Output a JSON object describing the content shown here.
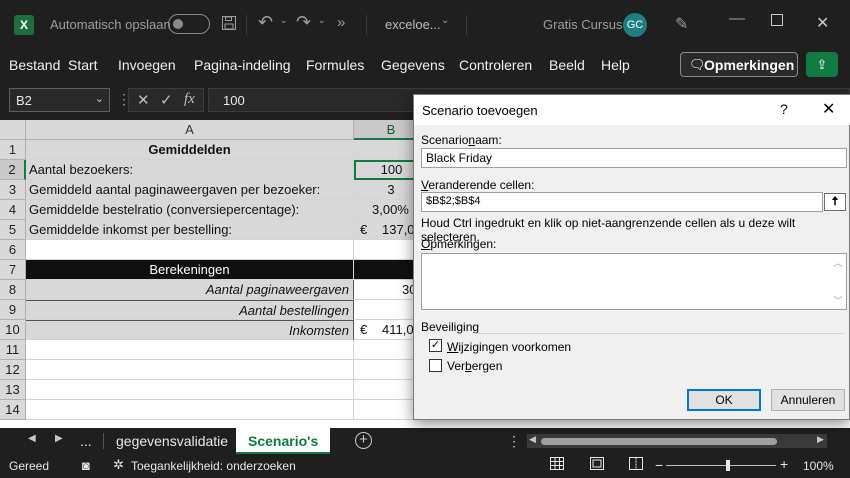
{
  "titlebar": {
    "app_logo": "X",
    "autosave_label": "Automatisch opslaan",
    "filename": "exceloe...",
    "more_glyph": "»",
    "title": "Gratis Cursus",
    "avatar": "GC",
    "icons": [
      "excel-logo",
      "save-icon",
      "undo-icon",
      "redo-icon",
      "pen-icon",
      "minimize-icon",
      "maximize-icon",
      "close-icon"
    ]
  },
  "menu": {
    "items": [
      "Bestand",
      "Start",
      "Invoegen",
      "Pagina-indeling",
      "Formules",
      "Gegevens",
      "Controleren",
      "Beeld",
      "Help"
    ],
    "comments_button": "Opmerkingen"
  },
  "formula_bar": {
    "name_box": "B2",
    "value": "100",
    "fx": "fx"
  },
  "grid": {
    "columns": [
      "A",
      "B"
    ],
    "rows": [
      {
        "n": "1",
        "a": "Gemiddelden",
        "b": ""
      },
      {
        "n": "2",
        "a": "Aantal bezoekers:",
        "b": "100"
      },
      {
        "n": "3",
        "a": "Gemiddeld aantal paginaweergaven per bezoeker:",
        "b": "3"
      },
      {
        "n": "4",
        "a": "Gemiddelde bestelratio (conversiepercentage):",
        "b": "3,00%"
      },
      {
        "n": "5",
        "a": "Gemiddelde inkomst per bestelling:",
        "b_cur": "€",
        "b": "137,0"
      },
      {
        "n": "6",
        "a": "",
        "b": ""
      },
      {
        "n": "7",
        "a": "Berekeningen",
        "b": ""
      },
      {
        "n": "8",
        "a": "Aantal paginaweergaven",
        "b": "30"
      },
      {
        "n": "9",
        "a": "Aantal bestellingen",
        "b": ""
      },
      {
        "n": "10",
        "a": "Inkomsten",
        "b_cur": "€",
        "b": "411,0"
      },
      {
        "n": "11",
        "a": "",
        "b": ""
      },
      {
        "n": "12",
        "a": "",
        "b": ""
      },
      {
        "n": "13",
        "a": "",
        "b": ""
      },
      {
        "n": "14",
        "a": "",
        "b": ""
      }
    ]
  },
  "sheet_tabs": {
    "ellipsis": "...",
    "tabs": [
      "gegevensvalidatie",
      "Scenario's"
    ],
    "active": "Scenario's"
  },
  "statusbar": {
    "ready": "Gereed",
    "accessibility": "Toegankelijkheid: onderzoeken",
    "zoom": "100%"
  },
  "dialog": {
    "title": "Scenario toevoegen",
    "help": "?",
    "name_label_pre": "Scenario",
    "name_label_key": "n",
    "name_label_post": "aam:",
    "name_value": "Black Friday",
    "cells_label_key": "V",
    "cells_label_post": "eranderende cellen:",
    "cells_value": "$B$2;$B$4",
    "hint": "Houd Ctrl ingedrukt en klik op niet-aangrenzende cellen als u deze wilt selecteren.",
    "comments_label_key": "O",
    "comments_label_post": "pmerkingen:",
    "comments_value": "",
    "protection_label": "Beveiliging",
    "prevent_changes_key": "W",
    "prevent_changes_post": "ijzigingen voorkomen",
    "prevent_changes_checked": true,
    "hide_pre": "Ver",
    "hide_key": "b",
    "hide_post": "ergen",
    "hide_checked": false,
    "ok": "OK",
    "cancel": "Annuleren"
  }
}
